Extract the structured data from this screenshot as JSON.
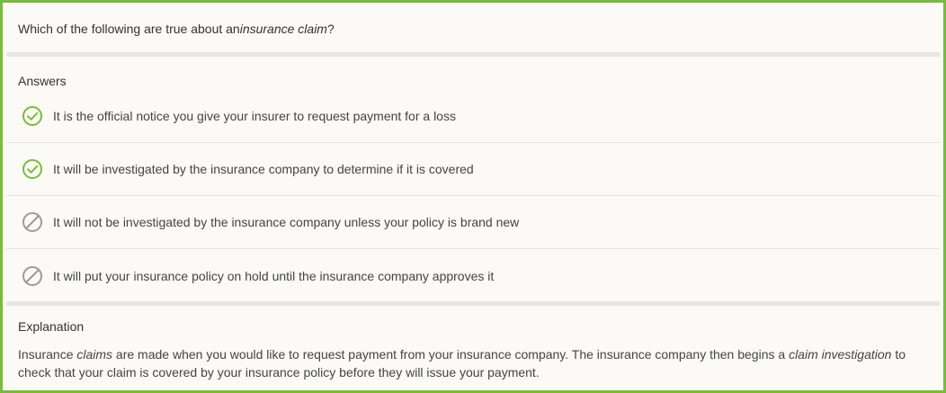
{
  "question": {
    "prefix": "Which of the following are true about an ",
    "term": "insurance claim",
    "suffix": "?"
  },
  "answers": {
    "header": "Answers",
    "items": [
      {
        "text": "It is the official notice you give your insurer to request payment for a loss",
        "status": "correct",
        "icon": "check-circle-icon"
      },
      {
        "text": "It will be investigated by the insurance company to determine if it is covered",
        "status": "correct",
        "icon": "check-circle-icon"
      },
      {
        "text": "It will not be investigated by the insurance company unless your policy is brand new",
        "status": "incorrect",
        "icon": "prohibited-icon"
      },
      {
        "text": "It will put your insurance policy on hold until the insurance company approves it",
        "status": "incorrect",
        "icon": "prohibited-icon"
      }
    ]
  },
  "explanation": {
    "header": "Explanation",
    "parts": [
      "Insurance ",
      "claims",
      " are made when you would like to request payment from your insurance company. The insurance company then begins a ",
      "claim investigation",
      " to check that your claim is covered by your insurance policy before they will issue your payment."
    ]
  },
  "colors": {
    "frame": "#7cba3d",
    "correct": "#7cba3d",
    "incorrect": "#9b9b9b",
    "background": "#fbfaf7",
    "separator": "#e8e6e1"
  }
}
